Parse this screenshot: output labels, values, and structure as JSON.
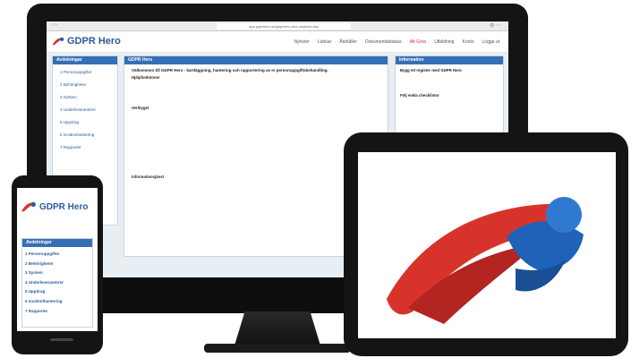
{
  "browser": {
    "url": "app.gdprhero.se/gdprhero-hos-vardarm.asp"
  },
  "brand": {
    "name": "GDPR Hero",
    "primary_color": "#2b5a9e",
    "accent_color": "#d8332a",
    "panel_color": "#356fb5"
  },
  "desktop": {
    "topnav": [
      "Nyheter",
      "Länkar",
      "Åtehåller",
      "Dokumentdatabas",
      "Att Göra",
      "Utbildning",
      "Konto",
      "Logga ut"
    ],
    "topnav_active": "Att Göra",
    "left_panel": {
      "title": "Avdelningar",
      "items": [
        "1 Personuppgifter",
        "2 Behörigheter",
        "3 System",
        "4 Underleverantörer",
        "5 Uppdrag",
        "6 Incidenthantering",
        "7 Rapporter"
      ]
    },
    "main_panel": {
      "header": "GDPR Hero",
      "title": "Välkommen till GDPR Hero - kartläggning, hantering och rapportering av er personuppgiftsbehandling.",
      "section1": "Hjälpfunktioner",
      "section2": "Verktyget",
      "section3": "Informationsjänst"
    },
    "right_panel": {
      "header": "Information",
      "block1_title": "Bygg ett register med GDPR Hero",
      "block2_title": "Följ enkla checklistor"
    }
  },
  "phone": {
    "panel_title": "Avdelningar",
    "items": [
      "1 Personuppgifter",
      "2 Behörigheter",
      "3 System",
      "4 Underleverantörer",
      "5 Uppdrag",
      "6 Incidenthantering",
      "7 Rapporter"
    ]
  },
  "tablet": {
    "icon": "gdpr-hero-logo-icon"
  }
}
